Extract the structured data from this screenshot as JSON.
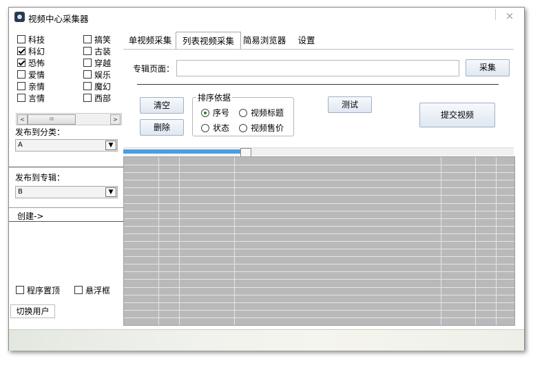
{
  "window": {
    "title": "视频中心采集器",
    "close_glyph": "⨯",
    "close_icon": "close-icon"
  },
  "categories": [
    {
      "label": "科技",
      "checked": false
    },
    {
      "label": "搞笑",
      "checked": false
    },
    {
      "label": "科幻",
      "checked": true
    },
    {
      "label": "古装",
      "checked": false
    },
    {
      "label": "恐怖",
      "checked": true
    },
    {
      "label": "穿越",
      "checked": false
    },
    {
      "label": "爱情",
      "checked": false
    },
    {
      "label": "娱乐",
      "checked": false
    },
    {
      "label": "亲情",
      "checked": false
    },
    {
      "label": "魔幻",
      "checked": false
    },
    {
      "label": "言情",
      "checked": false
    },
    {
      "label": "西部",
      "checked": false
    }
  ],
  "scrollbar": {
    "left_arrow": "<",
    "right_arrow": ">",
    "thumb_grip": "III"
  },
  "publish_category": {
    "label": "发布到分类：",
    "selected": "A",
    "arrow": "▼"
  },
  "publish_album": {
    "label": "发布到专辑：",
    "selected": "B",
    "arrow": "▼"
  },
  "create_link": "创建->",
  "options": [
    {
      "label": "程序置顶",
      "checked": false
    },
    {
      "label": "悬浮框",
      "checked": false
    }
  ],
  "switch_user": "切换用户",
  "tabs": [
    {
      "label": "单视频采集",
      "active": false
    },
    {
      "label": "列表视频采集",
      "active": true
    },
    {
      "label": "简易浏览器",
      "active": false
    },
    {
      "label": "设置",
      "active": false
    }
  ],
  "album_page": {
    "label": "专辑页面：",
    "value": "",
    "collect_button": "采集"
  },
  "buttons": {
    "clear": "清空",
    "delete": "删除",
    "test": "测试",
    "submit": "提交视频"
  },
  "sort": {
    "title": "排序依据",
    "options": [
      {
        "label": "序号",
        "selected": true
      },
      {
        "label": "视频标题",
        "selected": false
      },
      {
        "label": "状态",
        "selected": false
      },
      {
        "label": "视频售价",
        "selected": false
      }
    ]
  },
  "progress": {
    "fraction": 0.3,
    "accent": "#4a9ee2"
  },
  "results_grid": {
    "rows": 22,
    "columns": 6,
    "row_color": "#b9b9b9"
  }
}
